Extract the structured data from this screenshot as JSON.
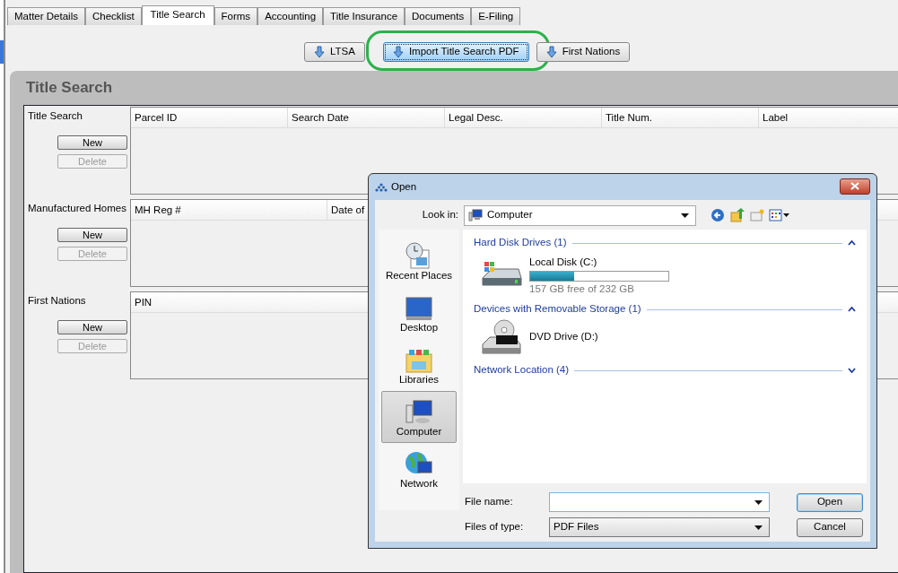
{
  "tabs": [
    {
      "label": "Matter Details",
      "selected": false
    },
    {
      "label": "Checklist",
      "selected": false
    },
    {
      "label": "Title Search",
      "selected": true
    },
    {
      "label": "Forms",
      "selected": false
    },
    {
      "label": "Accounting",
      "selected": false
    },
    {
      "label": "Title Insurance",
      "selected": false
    },
    {
      "label": "Documents",
      "selected": false
    },
    {
      "label": "E-Filing",
      "selected": false
    }
  ],
  "toolbar": [
    {
      "label": "LTSA",
      "focused": false,
      "circled": false
    },
    {
      "label": "Import Title Search PDF",
      "focused": true,
      "circled": true
    },
    {
      "label": "First Nations",
      "focused": false,
      "circled": false
    }
  ],
  "panel": {
    "title": "Title Search",
    "sections": [
      {
        "label": "Title Search",
        "columns": [
          "Parcel ID",
          "Search Date",
          "Legal Desc.",
          "Title Num.",
          "Label"
        ],
        "buttons": [
          {
            "label": "New",
            "disabled": false
          },
          {
            "label": "Delete",
            "disabled": true
          }
        ]
      },
      {
        "label": "Manufactured Homes",
        "columns": [
          "MH Reg #",
          "Date of"
        ],
        "buttons": [
          {
            "label": "New",
            "disabled": false
          },
          {
            "label": "Delete",
            "disabled": true
          }
        ]
      },
      {
        "label": "First Nations",
        "columns": [
          "PIN"
        ],
        "buttons": [
          {
            "label": "New",
            "disabled": false
          },
          {
            "label": "Delete",
            "disabled": true
          }
        ]
      }
    ]
  },
  "dialog": {
    "title": "Open",
    "look_in": {
      "label": "Look in:",
      "value": "Computer"
    },
    "places": [
      {
        "label": "Recent Places",
        "kind": "recent",
        "selected": false
      },
      {
        "label": "Desktop",
        "kind": "desktop",
        "selected": false
      },
      {
        "label": "Libraries",
        "kind": "libraries",
        "selected": false
      },
      {
        "label": "Computer",
        "kind": "computer",
        "selected": true
      },
      {
        "label": "Network",
        "kind": "network",
        "selected": false
      }
    ],
    "groups": [
      {
        "title": "Hard Disk Drives (1)",
        "expanded": true,
        "items": [
          {
            "kind": "hdd",
            "name": "Local Disk (C:)",
            "level": 0.32,
            "detail": "157 GB free of 232 GB"
          }
        ]
      },
      {
        "title": "Devices with Removable Storage (1)",
        "expanded": true,
        "items": [
          {
            "kind": "dvd",
            "name": "DVD Drive (D:)"
          }
        ]
      },
      {
        "title": "Network Location (4)",
        "expanded": false
      }
    ],
    "file_name": {
      "label": "File name:"
    },
    "file_type": {
      "label": "Files of type:",
      "value": "PDF Files"
    },
    "buttons": [
      {
        "label": "Open",
        "default": true
      },
      {
        "label": "Cancel",
        "default": false
      }
    ]
  }
}
